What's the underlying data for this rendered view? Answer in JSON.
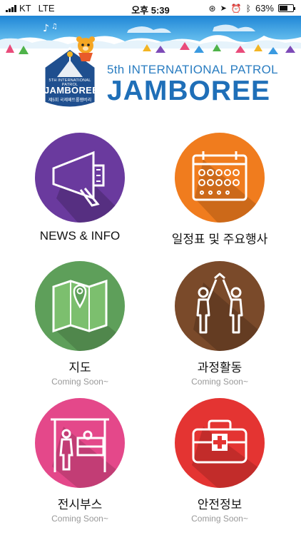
{
  "status_bar": {
    "carrier": "KT",
    "network": "LTE",
    "time": "오후 5:39",
    "battery_percent": "63%",
    "battery_level": 0.63
  },
  "header": {
    "badge_line1": "5TH INTERNATIONAL PATROL",
    "badge_line2": "JAMBOREE",
    "badge_line3": "제5회 국제패트롤잼버리",
    "subtitle": "5th INTERNATIONAL PATROL",
    "title": "JAMBOREE"
  },
  "menu": [
    {
      "label": "NEWS & INFO",
      "sub": "",
      "icon": "megaphone-icon",
      "color": "#6a3a9e"
    },
    {
      "label": "일정표 및 주요행사",
      "sub": "",
      "icon": "calendar-icon",
      "color": "#f07c1e"
    },
    {
      "label": "지도",
      "sub": "Coming Soon~",
      "icon": "map-icon",
      "color": "#5e9f5a"
    },
    {
      "label": "과정활동",
      "sub": "Coming Soon~",
      "icon": "high-five-icon",
      "color": "#7a4a2a"
    },
    {
      "label": "전시부스",
      "sub": "Coming Soon~",
      "icon": "exhibition-booth-icon",
      "color": "#e4488a"
    },
    {
      "label": "안전정보",
      "sub": "Coming Soon~",
      "icon": "first-aid-kit-icon",
      "color": "#e43432"
    }
  ]
}
